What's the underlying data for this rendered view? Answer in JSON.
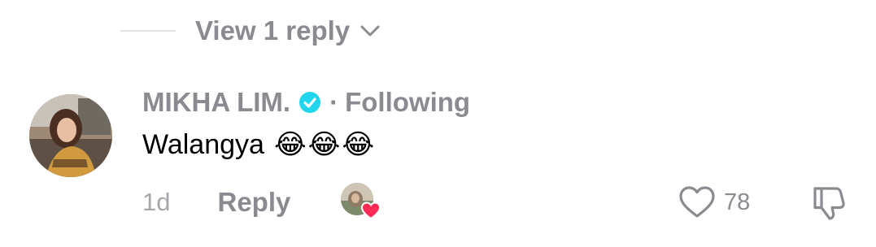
{
  "replies": {
    "view_label": "View 1 reply"
  },
  "comment": {
    "username": "MIKHA LIM.",
    "separator": "·",
    "follow_status": "Following",
    "text": "Walangya",
    "emojis": [
      "😂",
      "😂",
      "😂"
    ],
    "timestamp": "1d",
    "reply_label": "Reply",
    "like_count": "78"
  },
  "icons": {
    "verified": "verified-badge-icon",
    "chevron": "chevron-down-icon",
    "heart": "heart-outline-icon",
    "dislike": "thumbs-down-icon",
    "creator_heart": "creator-liked-heart-icon"
  },
  "colors": {
    "verified": "#20d5ec",
    "heart_red": "#fe2c55",
    "muted_text": "#8a8b91"
  }
}
